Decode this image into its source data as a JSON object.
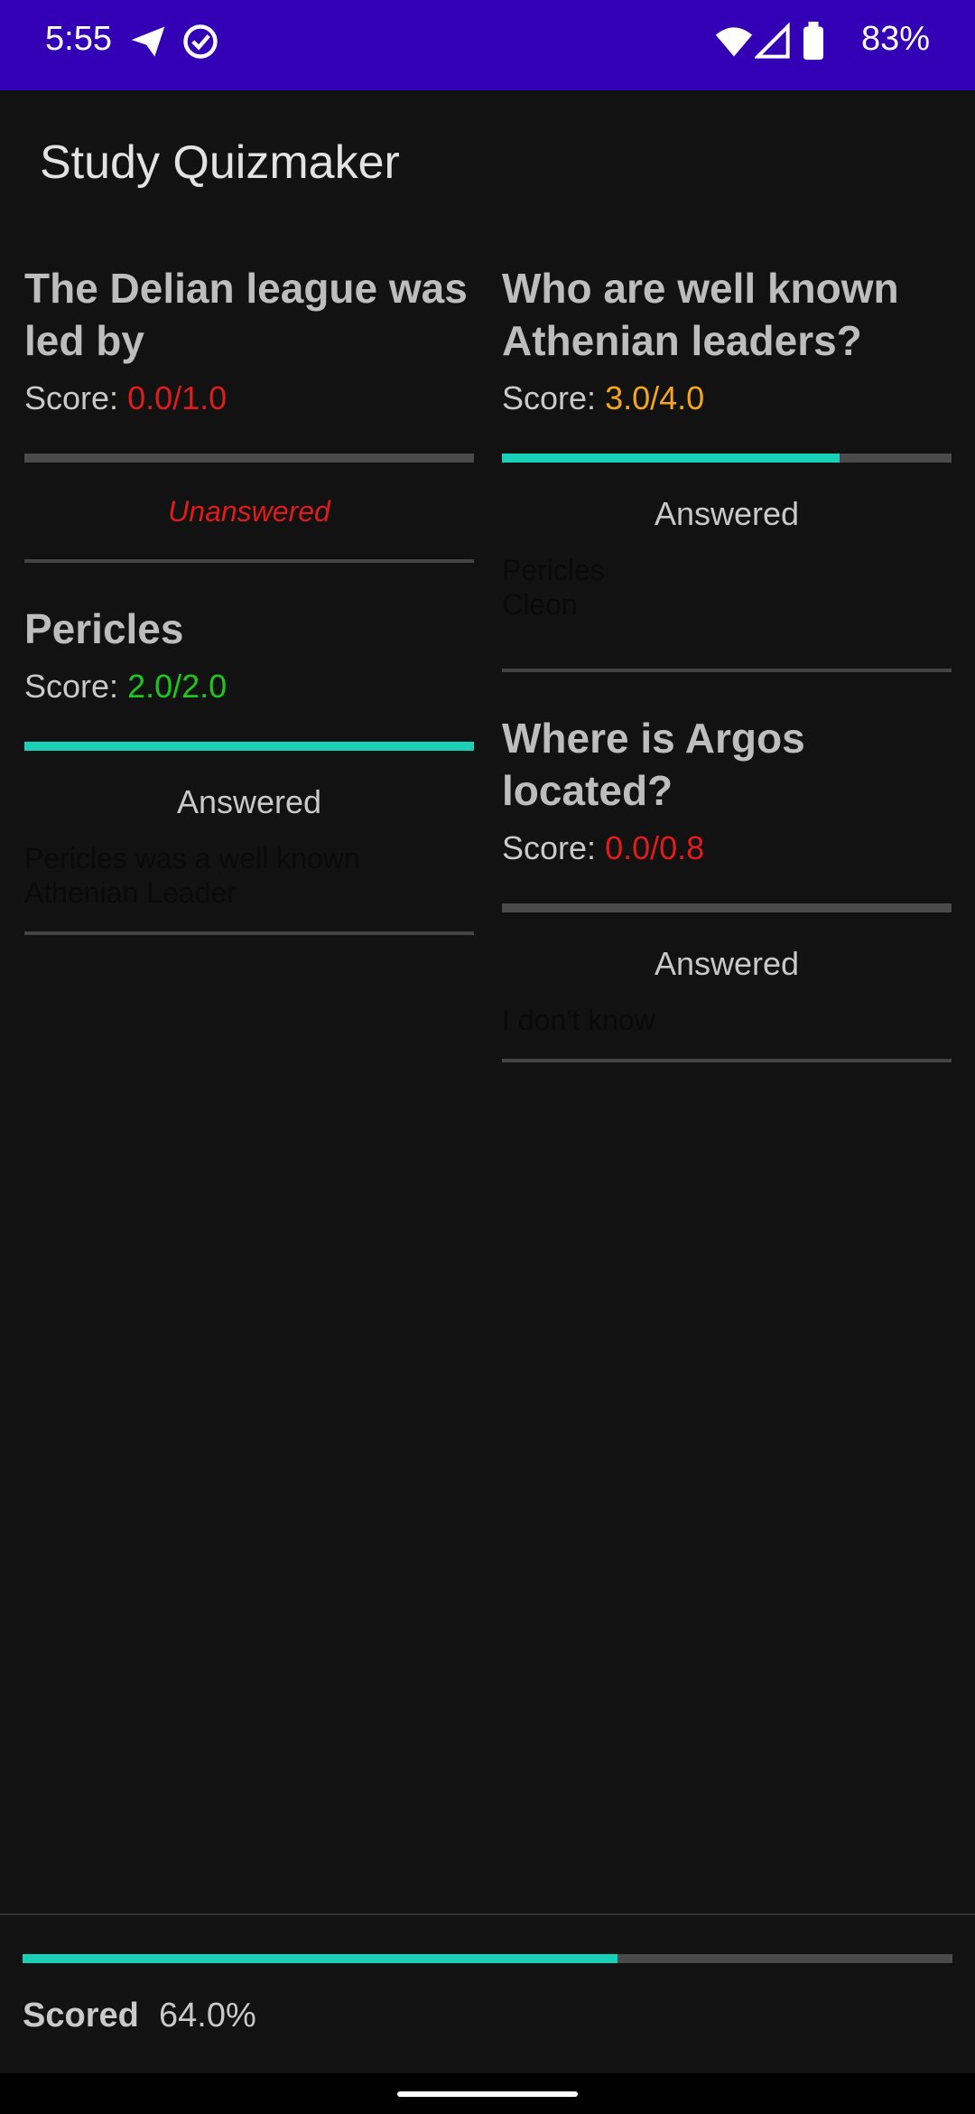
{
  "status_bar": {
    "time": "5:55",
    "battery": "83%",
    "icons": [
      "telegram-icon",
      "check-circle-icon",
      "wifi-icon",
      "signal-icon",
      "battery-icon"
    ]
  },
  "app": {
    "title": "Study Quizmaker"
  },
  "cards_left": [
    {
      "question": "The Delian league was led by",
      "score_label": "Score:",
      "score_value": "0.0/1.0",
      "score_color": "red",
      "progress": 0,
      "status": "Unanswered",
      "answer": ""
    },
    {
      "question": "Pericles",
      "score_label": "Score:",
      "score_value": "2.0/2.0",
      "score_color": "green",
      "progress": 1.0,
      "status": "Answered",
      "answer": "Pericles was a well known Athenian Leader"
    }
  ],
  "cards_right": [
    {
      "question": "Who are well known Athenian leaders?",
      "score_label": "Score:",
      "score_value": "3.0/4.0",
      "score_color": "orange",
      "progress": 0.75,
      "status": "Answered",
      "answer": "Pericles\nCleon"
    },
    {
      "question": "Where is Argos located?",
      "score_label": "Score:",
      "score_value": "0.0/0.8",
      "score_color": "red",
      "progress": 0,
      "status": "Answered",
      "answer": "I don't know"
    }
  ],
  "footer": {
    "label": "Scored",
    "value": "64.0%",
    "progress": 0.64
  },
  "colors": {
    "accent": "#19d1b8",
    "status_bar": "#3300b5",
    "red": "#e01b1b",
    "orange": "#f3a61a",
    "green": "#1ec71e"
  }
}
